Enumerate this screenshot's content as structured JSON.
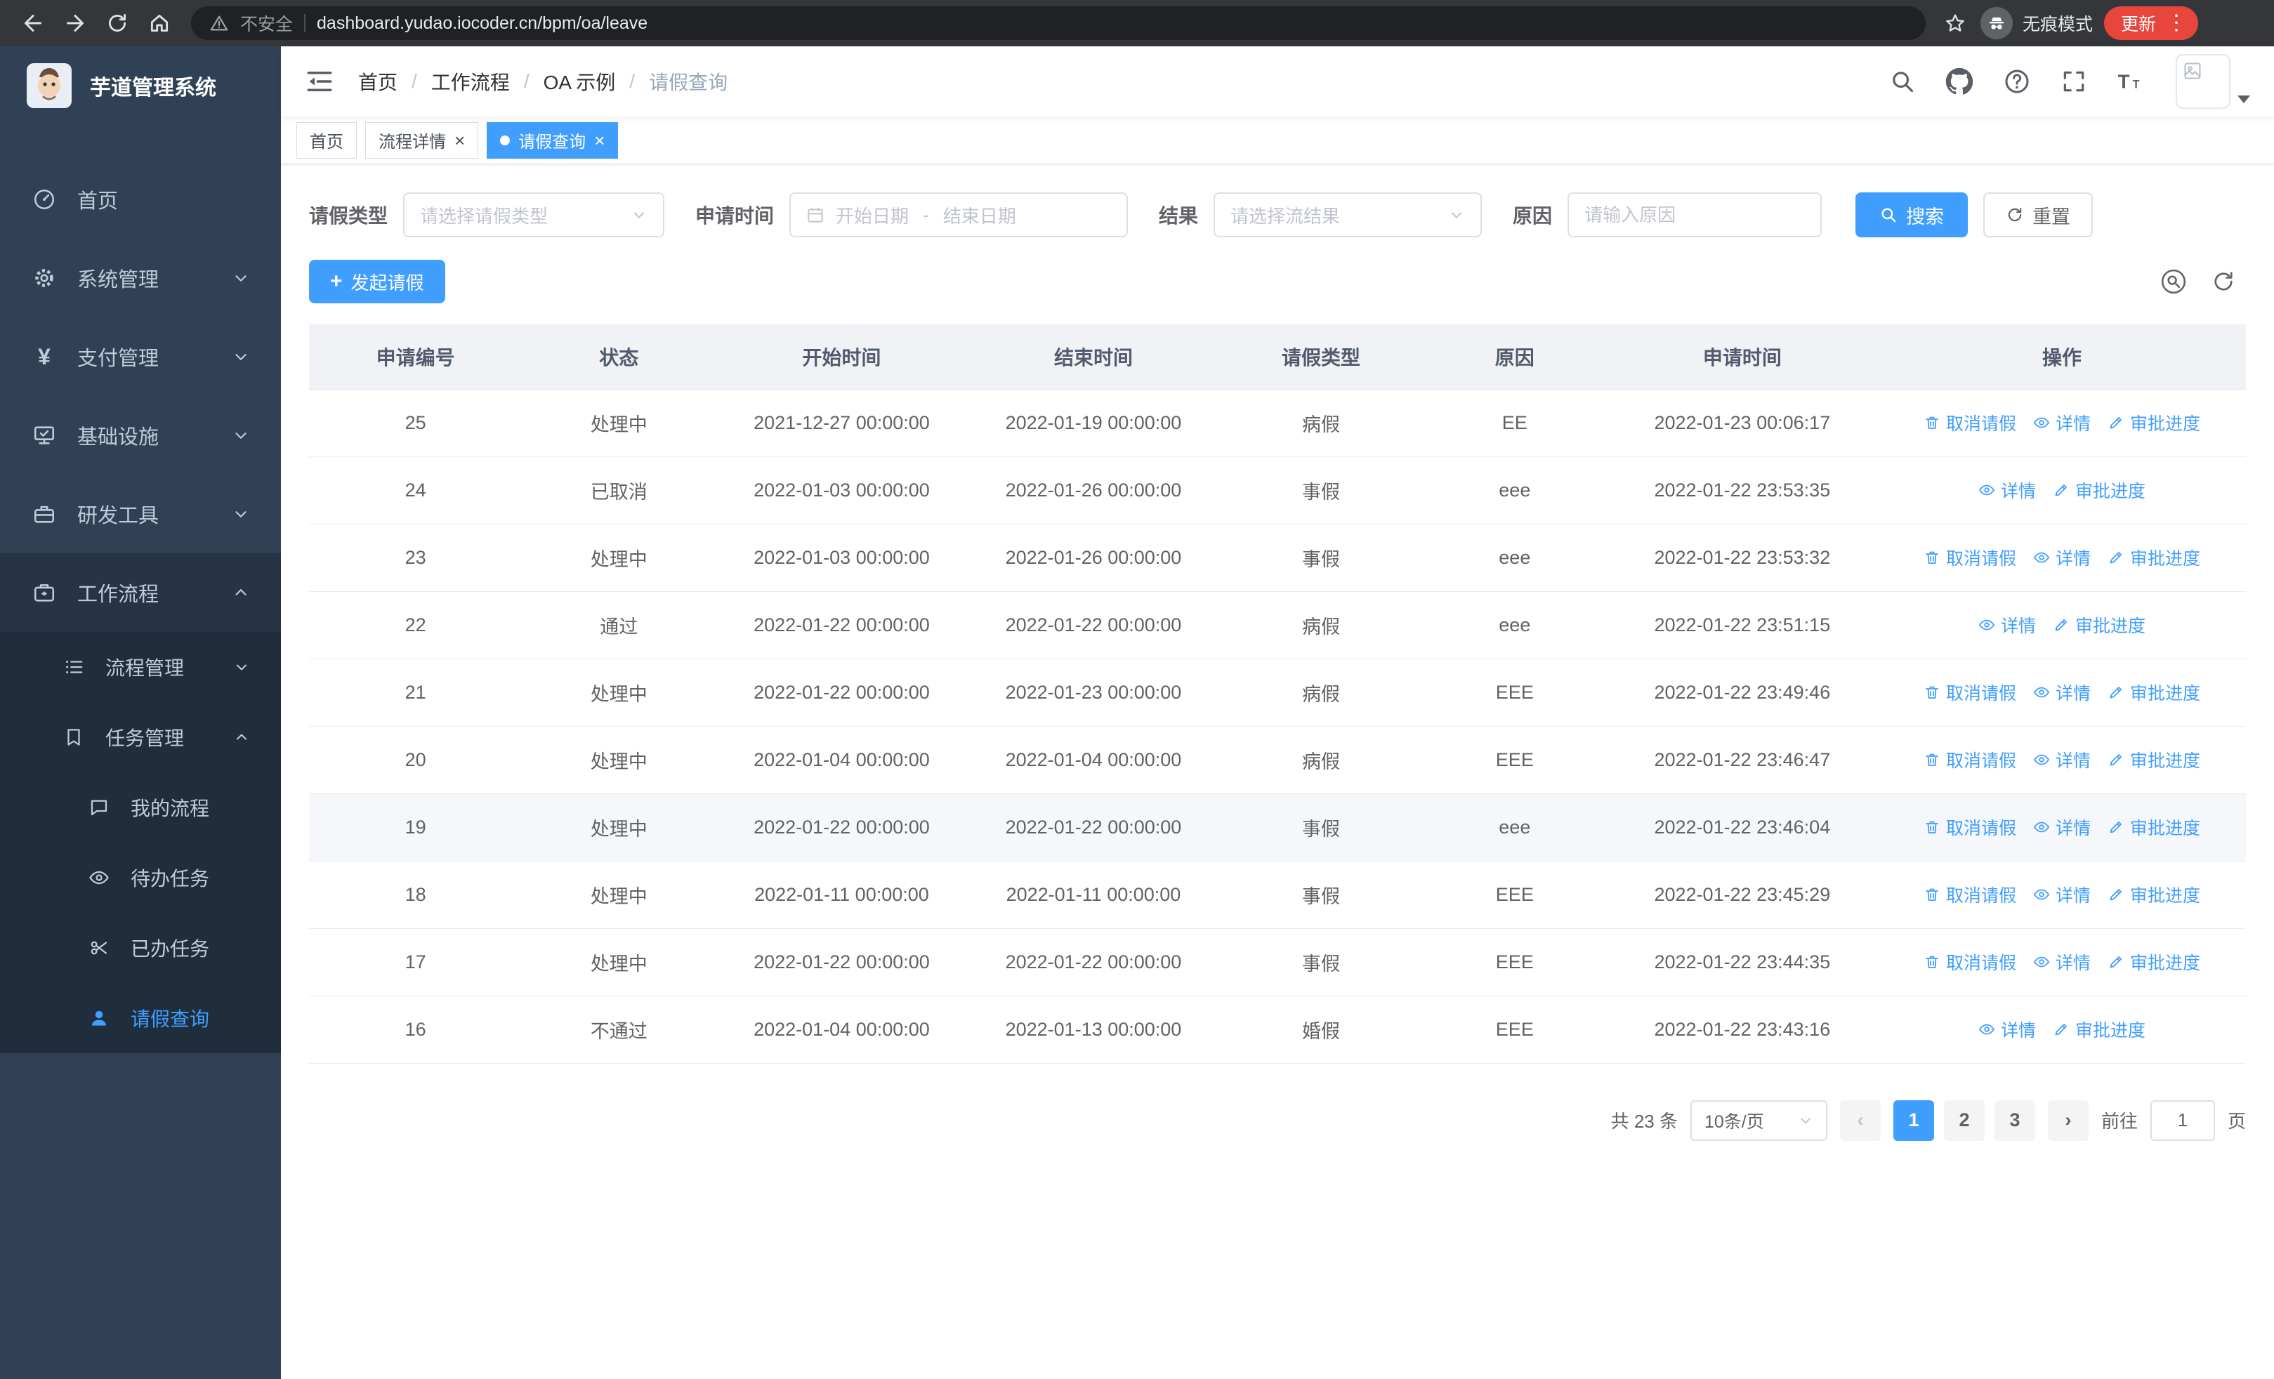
{
  "colors": {
    "primary": "#409eff",
    "sidebar_bg": "#304156",
    "submenu_bg": "#1f2d3d",
    "update_chip": "#e8453c",
    "active_tab": "#409eff"
  },
  "icons": {
    "close": "×",
    "prev": "‹",
    "next": "›",
    "kebab": "⋮",
    "breadcrumb_separator": "/",
    "yen": "¥",
    "plus": "+"
  },
  "browser": {
    "security_warning": "不安全",
    "url": "dashboard.yudao.iocoder.cn/bpm/oa/leave",
    "incognito_label": "无痕模式",
    "update_button": "更新"
  },
  "sidebar": {
    "logo_title": "芋道管理系统",
    "items": [
      {
        "label": "首页",
        "icon": "dashboard-icon"
      },
      {
        "label": "系统管理",
        "icon": "gear-icon"
      },
      {
        "label": "支付管理",
        "icon": "payment-icon"
      },
      {
        "label": "基础设施",
        "icon": "infrastructure-icon"
      },
      {
        "label": "研发工具",
        "icon": "devtools-icon"
      },
      {
        "label": "工作流程",
        "icon": "workflow-icon"
      }
    ],
    "workflow_children": [
      {
        "label": "流程管理"
      },
      {
        "label": "任务管理"
      }
    ],
    "task_children": [
      {
        "label": "我的流程"
      },
      {
        "label": "待办任务"
      },
      {
        "label": "已办任务"
      },
      {
        "label": "请假查询"
      }
    ]
  },
  "header": {
    "breadcrumb": [
      "首页",
      "工作流程",
      "OA 示例",
      "请假查询"
    ]
  },
  "tabs": [
    {
      "label": "首页",
      "closable": false,
      "active": false
    },
    {
      "label": "流程详情",
      "closable": true,
      "active": false
    },
    {
      "label": "请假查询",
      "closable": true,
      "active": true
    }
  ],
  "filters": {
    "leave_type_label": "请假类型",
    "leave_type_placeholder": "请选择请假类型",
    "apply_time_label": "申请时间",
    "start_date_placeholder": "开始日期",
    "date_separator": "-",
    "end_date_placeholder": "结束日期",
    "result_label": "结果",
    "result_placeholder": "请选择流结果",
    "reason_label": "原因",
    "reason_placeholder": "请输入原因",
    "search_button": "搜索",
    "reset_button": "重置"
  },
  "toolbar": {
    "create_button": "发起请假"
  },
  "table": {
    "columns": [
      "申请编号",
      "状态",
      "开始时间",
      "结束时间",
      "请假类型",
      "原因",
      "申请时间",
      "操作"
    ],
    "actions": {
      "cancel": "取消请假",
      "detail": "详情",
      "progress": "审批进度"
    },
    "rows": [
      {
        "id": "25",
        "status": "处理中",
        "start": "2021-12-27 00:00:00",
        "end": "2022-01-19 00:00:00",
        "type": "病假",
        "reason": "EE",
        "applied": "2022-01-23 00:06:17",
        "cancellable": true,
        "highlight": false
      },
      {
        "id": "24",
        "status": "已取消",
        "start": "2022-01-03 00:00:00",
        "end": "2022-01-26 00:00:00",
        "type": "事假",
        "reason": "eee",
        "applied": "2022-01-22 23:53:35",
        "cancellable": false,
        "highlight": false
      },
      {
        "id": "23",
        "status": "处理中",
        "start": "2022-01-03 00:00:00",
        "end": "2022-01-26 00:00:00",
        "type": "事假",
        "reason": "eee",
        "applied": "2022-01-22 23:53:32",
        "cancellable": true,
        "highlight": false
      },
      {
        "id": "22",
        "status": "通过",
        "start": "2022-01-22 00:00:00",
        "end": "2022-01-22 00:00:00",
        "type": "病假",
        "reason": "eee",
        "applied": "2022-01-22 23:51:15",
        "cancellable": false,
        "highlight": false
      },
      {
        "id": "21",
        "status": "处理中",
        "start": "2022-01-22 00:00:00",
        "end": "2022-01-23 00:00:00",
        "type": "病假",
        "reason": "EEE",
        "applied": "2022-01-22 23:49:46",
        "cancellable": true,
        "highlight": false
      },
      {
        "id": "20",
        "status": "处理中",
        "start": "2022-01-04 00:00:00",
        "end": "2022-01-04 00:00:00",
        "type": "病假",
        "reason": "EEE",
        "applied": "2022-01-22 23:46:47",
        "cancellable": true,
        "highlight": false
      },
      {
        "id": "19",
        "status": "处理中",
        "start": "2022-01-22 00:00:00",
        "end": "2022-01-22 00:00:00",
        "type": "事假",
        "reason": "eee",
        "applied": "2022-01-22 23:46:04",
        "cancellable": true,
        "highlight": true
      },
      {
        "id": "18",
        "status": "处理中",
        "start": "2022-01-11 00:00:00",
        "end": "2022-01-11 00:00:00",
        "type": "事假",
        "reason": "EEE",
        "applied": "2022-01-22 23:45:29",
        "cancellable": true,
        "highlight": false
      },
      {
        "id": "17",
        "status": "处理中",
        "start": "2022-01-22 00:00:00",
        "end": "2022-01-22 00:00:00",
        "type": "事假",
        "reason": "EEE",
        "applied": "2022-01-22 23:44:35",
        "cancellable": true,
        "highlight": false
      },
      {
        "id": "16",
        "status": "不通过",
        "start": "2022-01-04 00:00:00",
        "end": "2022-01-13 00:00:00",
        "type": "婚假",
        "reason": "EEE",
        "applied": "2022-01-22 23:43:16",
        "cancellable": false,
        "highlight": false
      }
    ]
  },
  "pagination": {
    "total": "共 23 条",
    "page_size": "10条/页",
    "pages": [
      "1",
      "2",
      "3"
    ],
    "active_page": "1",
    "goto_label": "前往",
    "goto_value": "1",
    "goto_suffix": "页"
  }
}
